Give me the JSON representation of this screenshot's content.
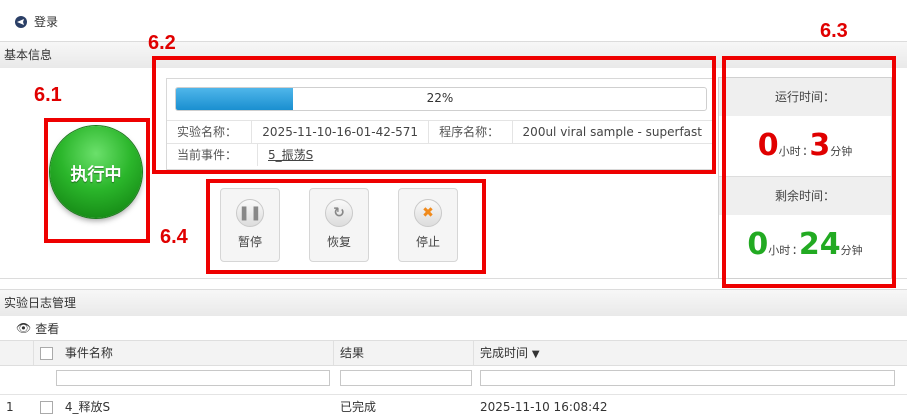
{
  "window": {
    "login_label": "登录"
  },
  "basic_section": {
    "title": "基本信息"
  },
  "status": {
    "label": "执行中",
    "color": "#22aa22"
  },
  "progress": {
    "percent": 22,
    "text": "22%"
  },
  "experiment": {
    "name_label": "实验名称：",
    "name_value": "2025-11-10-16-01-42-571",
    "program_label": "程序名称：",
    "program_value": "200ul viral sample - superfast",
    "event_label": "当前事件：",
    "event_value": "5_振荡S"
  },
  "controls": {
    "pause_label": "暂停",
    "resume_label": "恢复",
    "stop_label": "停止"
  },
  "time": {
    "run_label": "运行时间：",
    "run_hours": "0",
    "run_minutes": "3",
    "remain_label": "剩余时间：",
    "remain_hours": "0",
    "remain_minutes": "24",
    "hour_unit": "小时",
    "minute_unit": "分钟",
    "separator": ":",
    "run_color": "#e00000",
    "remain_color": "#22aa22"
  },
  "annotations": {
    "a1": "6.1",
    "a2": "6.2",
    "a3": "6.3",
    "a4": "6.4",
    "color": "#ee0000"
  },
  "log_section": {
    "title": "实验日志管理",
    "view_label": "查看"
  },
  "table": {
    "columns": [
      "事件名称",
      "结果",
      "完成时间"
    ],
    "sort_indicator": "▼",
    "rows": [
      {
        "index": "1",
        "event": "4_释放S",
        "result": "已完成",
        "time": "2025-11-10 16:08:42"
      }
    ]
  }
}
